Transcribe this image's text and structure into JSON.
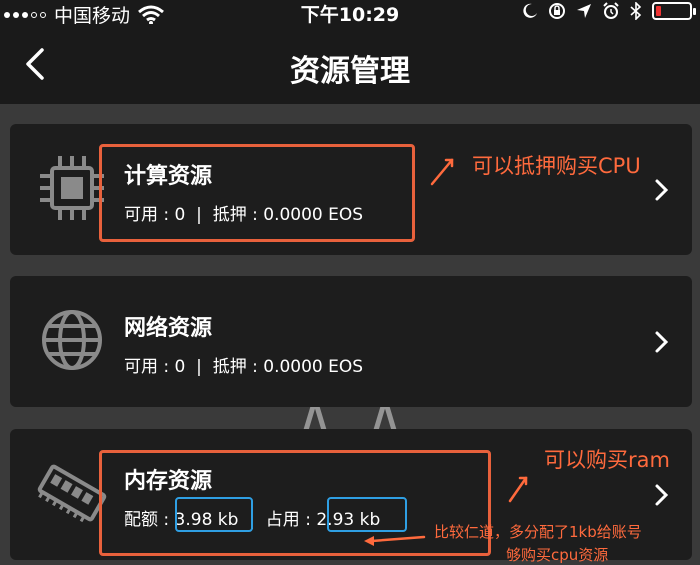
{
  "status_bar": {
    "carrier": "中国移动",
    "time": "下午10:29"
  },
  "nav": {
    "title": "资源管理"
  },
  "cards": [
    {
      "title": "计算资源",
      "label1": "可用",
      "value1": "0",
      "label2": "抵押",
      "value2": "0.0000 EOS",
      "icon": "cpu-chip-icon"
    },
    {
      "title": "网络资源",
      "label1": "可用",
      "value1": "0",
      "label2": "抵押",
      "value2": "0.0000 EOS",
      "icon": "globe-icon"
    },
    {
      "title": "内存资源",
      "label1": "配额",
      "value1": "3.98 kb",
      "label2": "占用",
      "value2": "2.93 kb",
      "icon": "memory-stick-icon"
    }
  ],
  "annotations": {
    "cpu_note": "可以抵押购买CPU",
    "ram_note": "可以购买ram",
    "extra_note_line1": "比较仁道，多分配了1kb给账号",
    "extra_note_line2": "够购买cpu资源"
  },
  "colors": {
    "annotation": "#ff6a3d",
    "highlight_box": "#e8613c",
    "value_box": "#2f9fe3",
    "card_bg": "#1d1d1d",
    "page_bg": "#3a3a3a"
  }
}
